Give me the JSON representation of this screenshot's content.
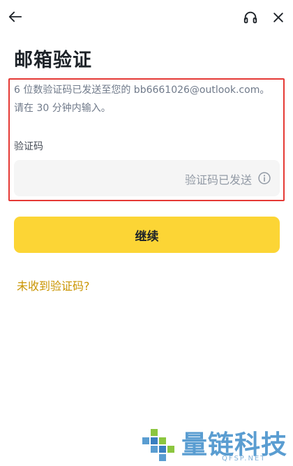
{
  "header": {
    "back_icon": "arrow-left-icon",
    "support_icon": "headset-icon",
    "close_icon": "close-icon"
  },
  "page": {
    "title": "邮箱验证",
    "description": "6 位数验证码已发送至您的 bb6661026@outlook.com。请在 30 分钟内输入。"
  },
  "form": {
    "code_label": "验证码",
    "code_value": "",
    "code_status": "验证码已发送",
    "info_icon": "info-circle-icon"
  },
  "actions": {
    "continue_label": "继续",
    "resend_link": "未收到验证码?"
  },
  "watermark": {
    "text": "量链科技",
    "sub": "QFSP.NET"
  },
  "colors": {
    "primary": "#fcd535",
    "link": "#c99400",
    "highlight_border": "#e53935"
  }
}
